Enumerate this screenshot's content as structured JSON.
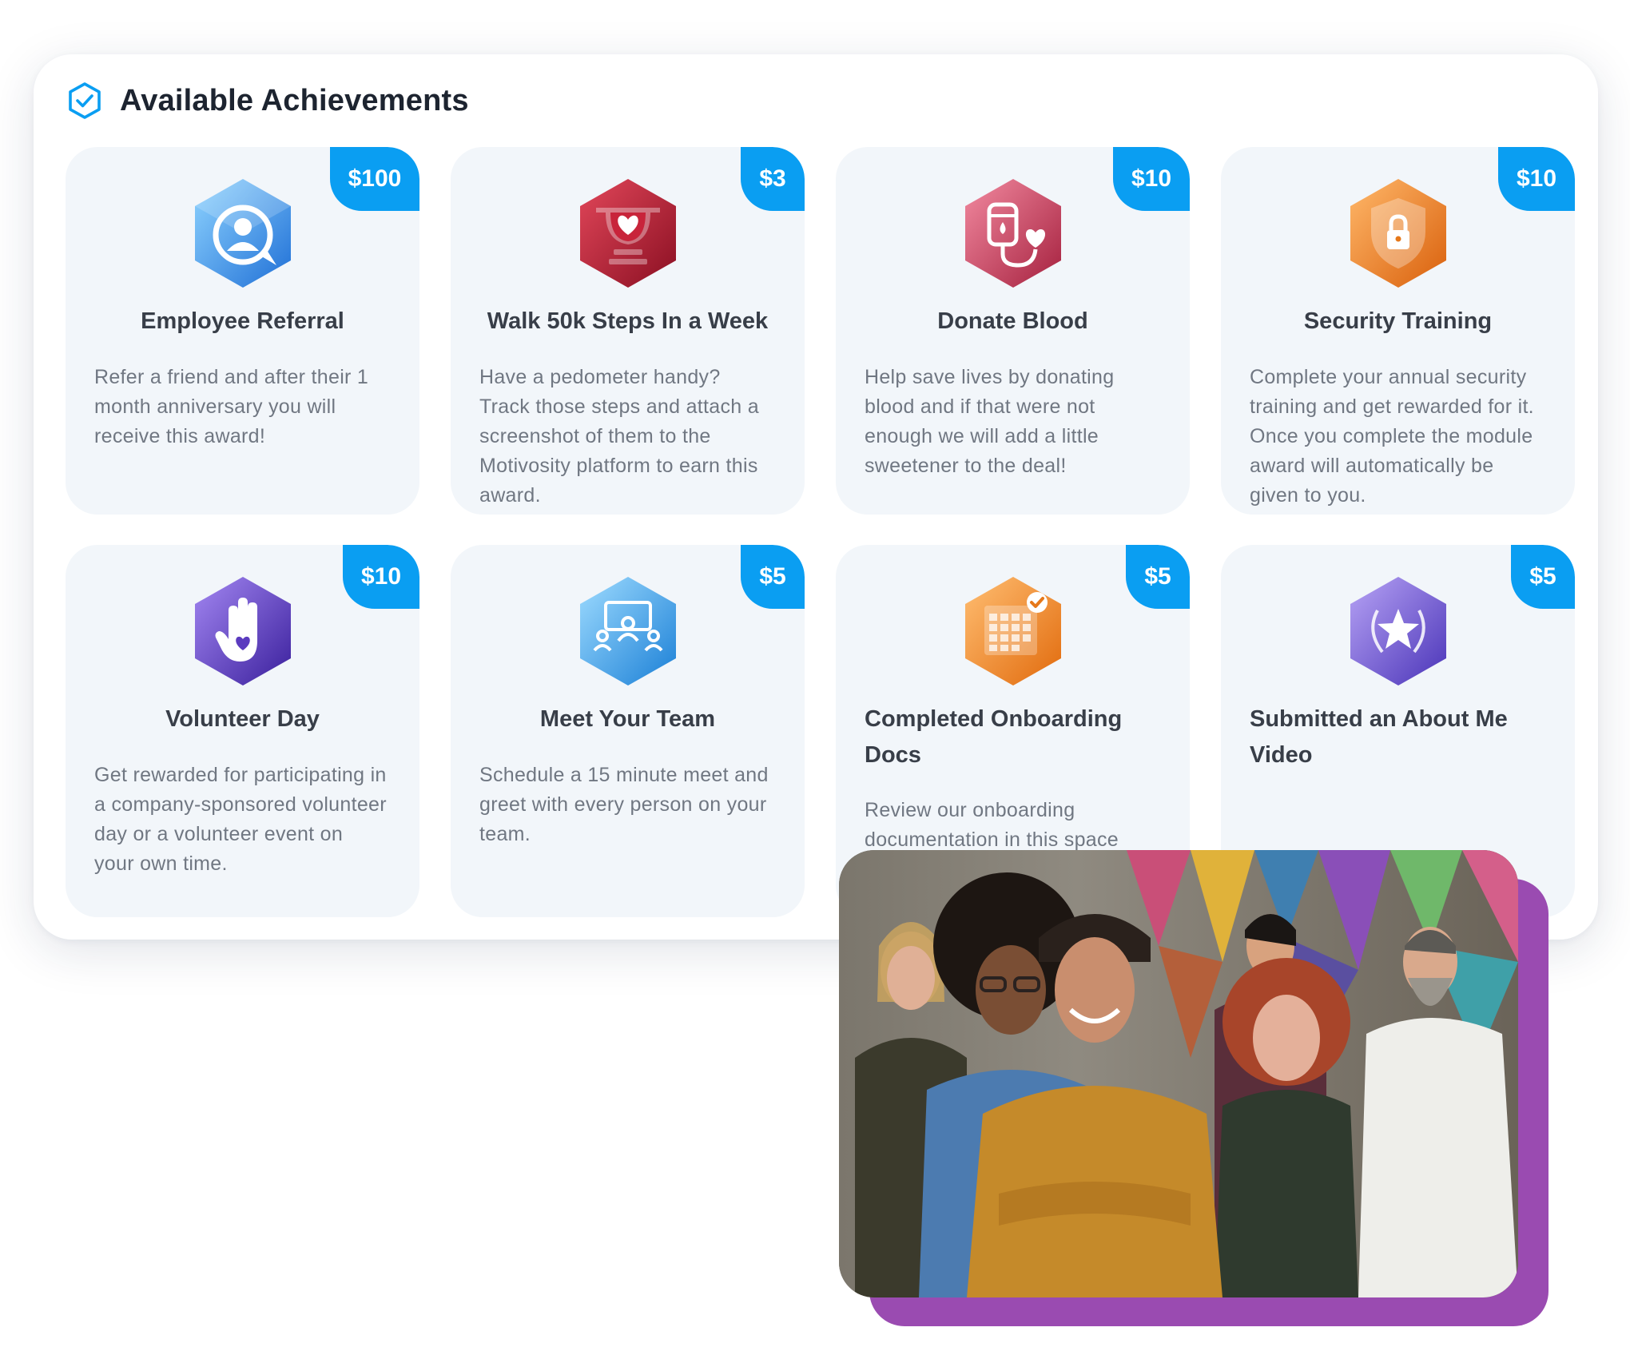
{
  "panel": {
    "title": "Available Achievements",
    "icon": "verified-check-hexagon-icon",
    "accent_color": "#0a9ef2"
  },
  "achievements": [
    {
      "title": "Employee Referral",
      "amount": "$100",
      "icon": "referral-person-icon",
      "color": "#2f8fe8",
      "description": "Refer a friend and after their 1 month anniversary you will receive this award!"
    },
    {
      "title": "Walk 50k Steps In a Week",
      "amount": "$3",
      "icon": "trophy-heart-icon",
      "color": "#a8182c",
      "description": "Have a pedometer handy? Track those steps and attach a screenshot of them to the Motivosity platform to earn this award."
    },
    {
      "title": "Donate Blood",
      "amount": "$10",
      "icon": "blood-bag-heart-icon",
      "color": "#c93a5a",
      "description": "Help save lives by donating blood and if that were not enough we will add a little sweetener to the deal!"
    },
    {
      "title": "Security Training",
      "amount": "$10",
      "icon": "shield-lock-icon",
      "color": "#e6781a",
      "description": "Complete your annual security training and get rewarded for it. Once you complete the module award will automatically be given to you."
    },
    {
      "title": "Volunteer Day",
      "amount": "$10",
      "icon": "raised-hand-heart-icon",
      "color": "#5b3bbf",
      "description": "Get rewarded for participating in a company-sponsored volunteer day or a volunteer event on your own time."
    },
    {
      "title": "Meet Your Team",
      "amount": "$5",
      "icon": "team-meeting-icon",
      "color": "#2a9be8",
      "description": "Schedule a 15 minute meet and greet with every person on your team."
    },
    {
      "title": "Completed Onboarding Docs",
      "amount": "$5",
      "icon": "calendar-check-icon",
      "color": "#f08a1c",
      "description": "Review our onboarding documentation in this space"
    },
    {
      "title": "Submitted an About Me Video",
      "amount": "$5",
      "icon": "star-laurel-icon",
      "color": "#6b55d4",
      "description": ""
    }
  ],
  "photo": {
    "icon": "team-group-photo",
    "frame_color": "#9a4bb1"
  }
}
